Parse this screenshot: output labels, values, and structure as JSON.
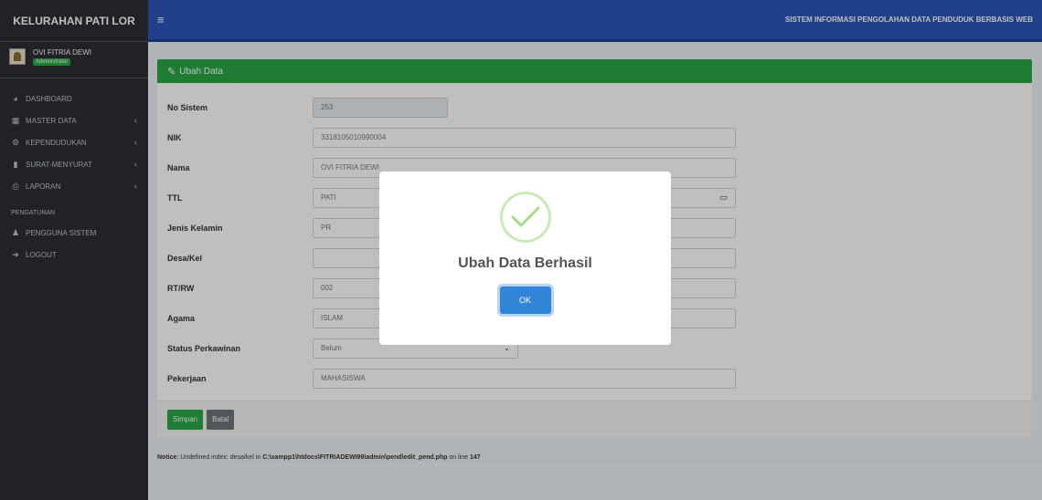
{
  "sidebar": {
    "brand": "KELURAHAN PATI LOR",
    "user_name": "OVI FITRIA DEWI",
    "user_role": "Administrator",
    "items": [
      {
        "label": "DASHBOARD",
        "icon": "tachometer-icon"
      },
      {
        "label": "MASTER DATA",
        "icon": "table-icon"
      },
      {
        "label": "KEPENDUDUKAN",
        "icon": "cogs-icon"
      },
      {
        "label": "SURAT-MENYURAT",
        "icon": "file-icon"
      },
      {
        "label": "LAPORAN",
        "icon": "print-icon"
      }
    ],
    "section_header": "PENGATURAN",
    "settings_items": [
      {
        "label": "PENGGUNA SISTEM",
        "icon": "user-icon"
      },
      {
        "label": "LOGOUT",
        "icon": "logout-icon"
      }
    ]
  },
  "navbar": {
    "title": "SISTEM INFORMASI PENGOLAHAN DATA PENDUDUK BERBASIS WEB"
  },
  "card": {
    "title": "Ubah Data",
    "fields": {
      "no_sistem": {
        "label": "No Sistem",
        "value": "253"
      },
      "nik": {
        "label": "NIK",
        "value": "3318105010990004"
      },
      "nama": {
        "label": "Nama",
        "value": "OVI FITRIA DEWI"
      },
      "ttl": {
        "label": "TTL",
        "value": "PATI"
      },
      "jenis_kelamin": {
        "label": "Jenis Kelamin",
        "value": "PR"
      },
      "desa_kel": {
        "label": "Desa/Kel",
        "value": ""
      },
      "rt_rw": {
        "label": "RT/RW",
        "value": "002"
      },
      "agama": {
        "label": "Agama",
        "value": "ISLAM"
      },
      "status_perkawinan": {
        "label": "Status Perkawinan",
        "value": "Belum"
      },
      "pekerjaan": {
        "label": "Pekerjaan",
        "value": "MAHASISWA"
      }
    },
    "save_label": "Simpan",
    "cancel_label": "Batal"
  },
  "notice": {
    "prefix": "Notice",
    "message": ": Undefined index: desa/kel in ",
    "path": "C:\\xampp1\\htdocs\\FITRIADEWI99\\admin\\pend\\edit_pend.php",
    "on_line": " on line ",
    "line": "147"
  },
  "modal": {
    "title": "Ubah Data Berhasil",
    "ok_label": "OK"
  },
  "colors": {
    "navbar": "#2b57b7",
    "sidebar": "#2b2e33",
    "card_header": "#28a745",
    "ok_button": "#3085d6"
  }
}
